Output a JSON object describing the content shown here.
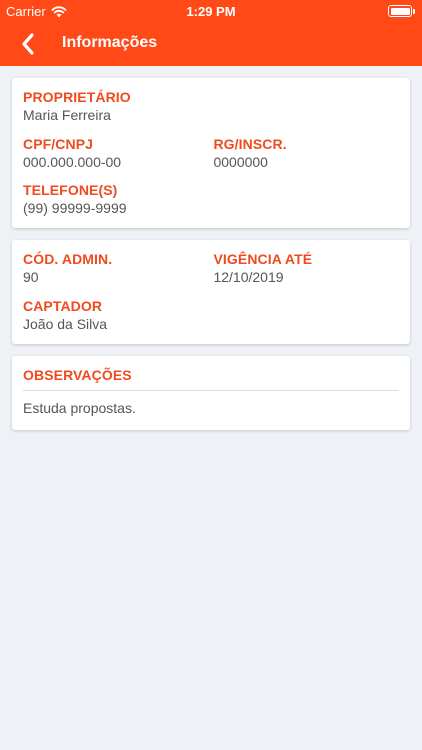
{
  "status_bar": {
    "carrier": "Carrier",
    "time": "1:29 PM"
  },
  "nav": {
    "title": "Informações"
  },
  "card1": {
    "owner_label": "PROPRIETÁRIO",
    "owner_value": "Maria Ferreira",
    "cpf_label": "CPF/CNPJ",
    "cpf_value": "000.000.000-00",
    "rg_label": "RG/INSCR.",
    "rg_value": "0000000",
    "phone_label": "TELEFONE(S)",
    "phone_value": "(99) 99999-9999"
  },
  "card2": {
    "admin_code_label": "CÓD. ADMIN.",
    "admin_code_value": "90",
    "validity_label": "VIGÊNCIA ATÉ",
    "validity_value": "12/10/2019",
    "captator_label": "CAPTADOR",
    "captator_value": "João da Silva"
  },
  "card3": {
    "notes_label": "OBSERVAÇÕES",
    "notes_value": "Estuda propostas."
  },
  "colors": {
    "accent": "#FF4A17",
    "label": "#F04A1E",
    "background": "#EEF1F5"
  }
}
